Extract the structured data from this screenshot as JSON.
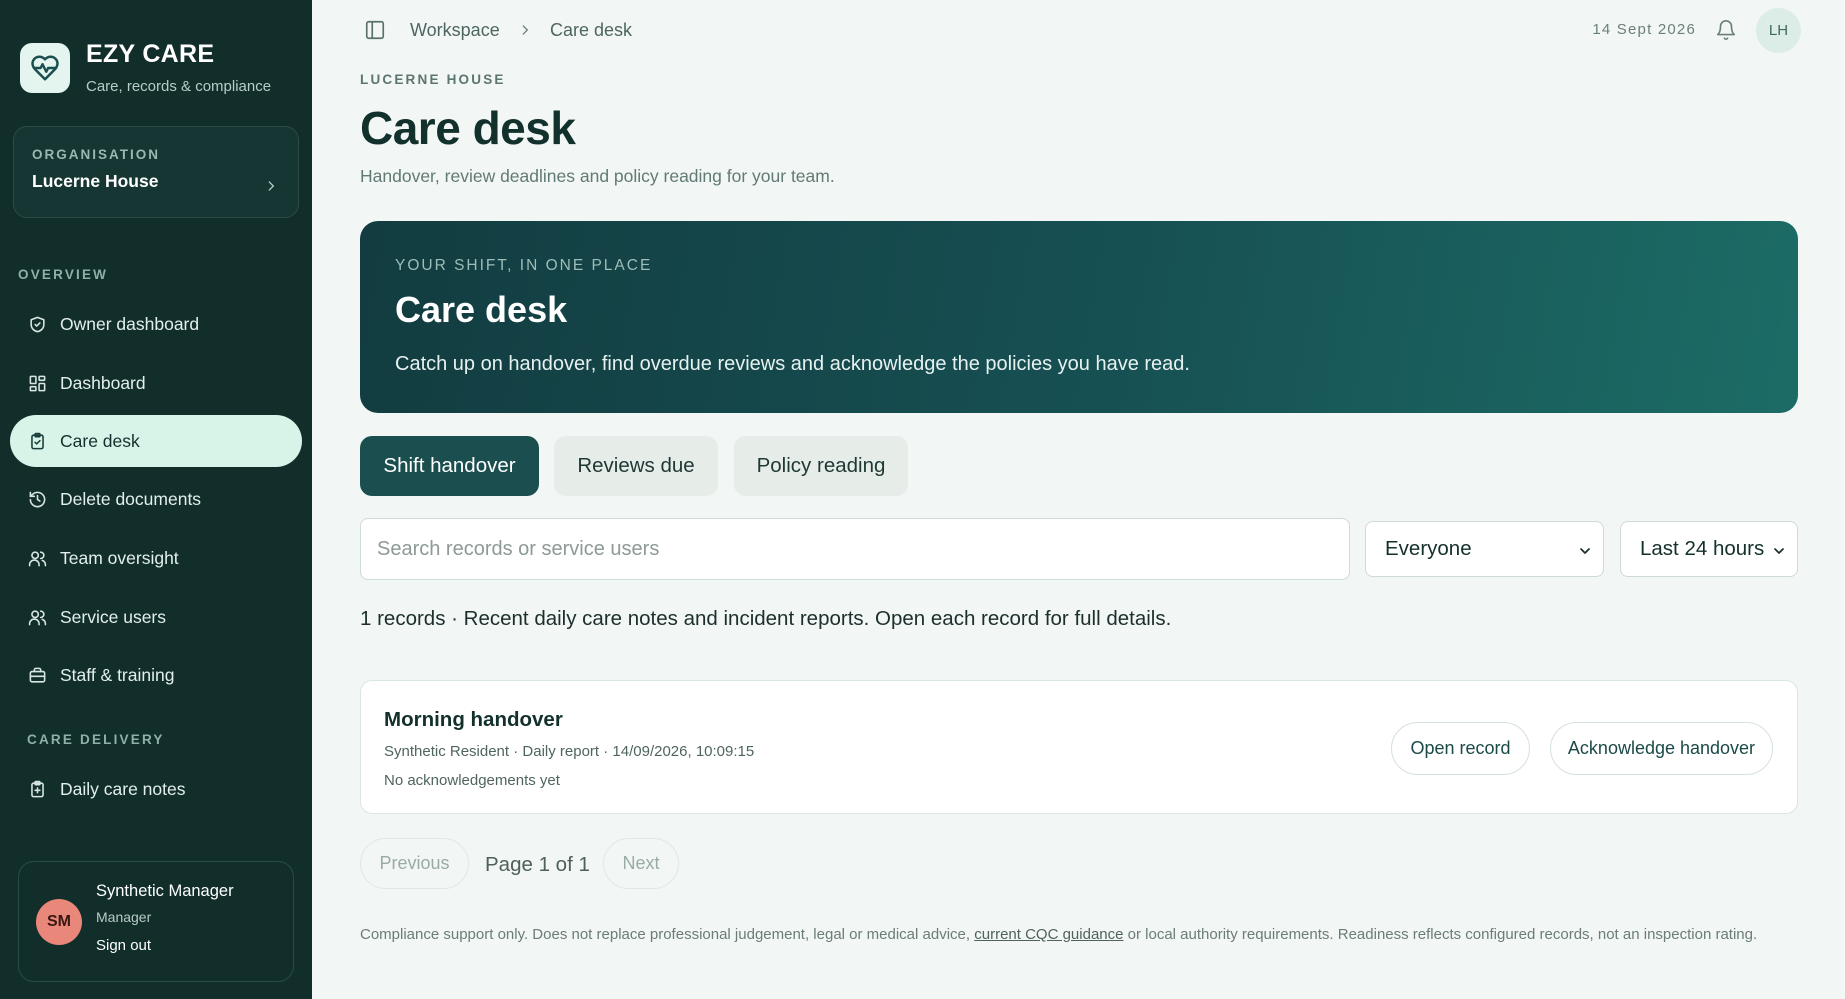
{
  "brand": {
    "name": "EZY CARE",
    "tagline": "Care, records & compliance",
    "logo_icon": "heart-pulse-icon"
  },
  "organisation": {
    "label": "ORGANISATION",
    "name": "Lucerne House"
  },
  "sidebar": {
    "sections": [
      {
        "label": "OVERVIEW"
      },
      {
        "label": "CARE DELIVERY"
      }
    ],
    "items": [
      {
        "label": "Owner dashboard",
        "icon": "shield-check-icon"
      },
      {
        "label": "Dashboard",
        "icon": "layout-grid-icon"
      },
      {
        "label": "Care desk",
        "icon": "clipboard-check-icon",
        "active": true
      },
      {
        "label": "Delete documents",
        "icon": "history-icon"
      },
      {
        "label": "Team oversight",
        "icon": "users-icon"
      },
      {
        "label": "Service users",
        "icon": "users-icon"
      },
      {
        "label": "Staff & training",
        "icon": "briefcase-icon"
      },
      {
        "label": "Daily care notes",
        "icon": "clipboard-plus-icon"
      }
    ]
  },
  "user": {
    "initials": "SM",
    "name": "Synthetic Manager",
    "role": "Manager",
    "signout": "Sign out",
    "avatar_color": "#e9877a"
  },
  "topbar": {
    "breadcrumb": [
      "Workspace",
      "Care desk"
    ],
    "date": "14 Sept 2026",
    "avatar_initials": "LH"
  },
  "header": {
    "eyebrow": "LUCERNE HOUSE",
    "title": "Care desk",
    "subtitle": "Handover, review deadlines and policy reading for your team."
  },
  "hero": {
    "eyebrow": "YOUR SHIFT, IN ONE PLACE",
    "title": "Care desk",
    "text": "Catch up on handover, find overdue reviews and acknowledge the policies you have read."
  },
  "tabs": [
    {
      "label": "Shift handover",
      "active": true
    },
    {
      "label": "Reviews due",
      "active": false
    },
    {
      "label": "Policy reading",
      "active": false
    }
  ],
  "filters": {
    "search_placeholder": "Search records or service users",
    "search_value": "",
    "audience": "Everyone",
    "period": "Last 24 hours"
  },
  "records_summary": "1 records · Recent daily care notes and incident reports. Open each record for full details.",
  "records": [
    {
      "title": "Morning handover",
      "meta": "Synthetic Resident · Daily report · 14/09/2026, 10:09:15",
      "ack_status": "No acknowledgements yet",
      "open_label": "Open record",
      "ack_label": "Acknowledge handover"
    }
  ],
  "pagination": {
    "previous": "Previous",
    "page_text": "Page 1 of 1",
    "next": "Next"
  },
  "footer": {
    "before": "Compliance support only. Does not replace professional judgement, legal or medical advice, ",
    "link": "current CQC guidance",
    "after": " or local authority requirements. Readiness reflects configured records, not an inspection rating."
  },
  "colors": {
    "sidebar_bg": "#112e2b",
    "accent": "#1b4e4f",
    "active_nav": "#d8f4e8",
    "page_bg": "#f2f6f4"
  }
}
